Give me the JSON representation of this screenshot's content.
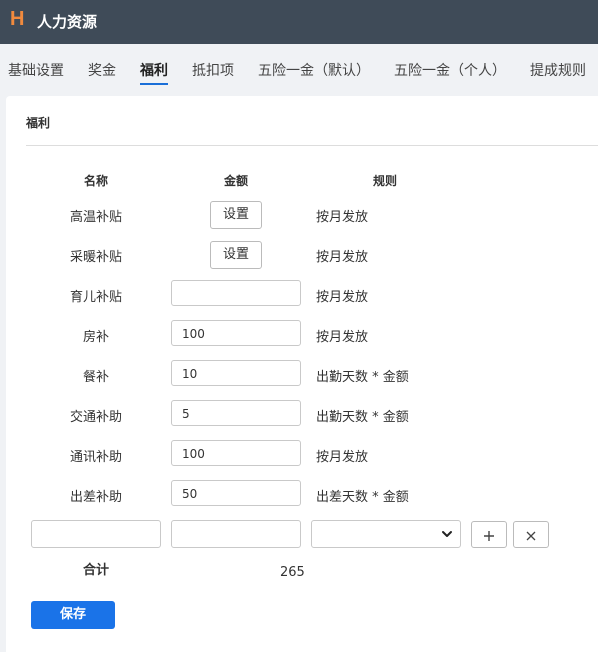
{
  "app": {
    "logo": "H",
    "title": "人力资源"
  },
  "tabs": [
    {
      "label": "基础设置",
      "active": false
    },
    {
      "label": "奖金",
      "active": false
    },
    {
      "label": "福利",
      "active": true
    },
    {
      "label": "抵扣项",
      "active": false
    },
    {
      "label": "五险一金（默认）",
      "active": false
    },
    {
      "label": "五险一金（个人）",
      "active": false
    },
    {
      "label": "提成规则",
      "active": false
    }
  ],
  "section": {
    "title": "福利"
  },
  "columns": {
    "name": "名称",
    "amount": "金额",
    "rule": "规则"
  },
  "rows": [
    {
      "name": "高温补贴",
      "amount_button": "设置",
      "rule": "按月发放"
    },
    {
      "name": "采暖补贴",
      "amount_button": "设置",
      "rule": "按月发放"
    },
    {
      "name": "育儿补贴",
      "amount": "",
      "rule": "按月发放"
    },
    {
      "name": "房补",
      "amount": "100",
      "rule": "按月发放"
    },
    {
      "name": "餐补",
      "amount": "10",
      "rule": "出勤天数 * 金额"
    },
    {
      "name": "交通补助",
      "amount": "5",
      "rule": "出勤天数 * 金额"
    },
    {
      "name": "通讯补助",
      "amount": "100",
      "rule": "按月发放"
    },
    {
      "name": "出差补助",
      "amount": "50",
      "rule": "出差天数 * 金额"
    }
  ],
  "new_row": {
    "name": "",
    "amount": "",
    "rule": "",
    "add_icon": "plus-icon",
    "remove_icon": "close-icon"
  },
  "total": {
    "label": "合计",
    "value": "265"
  },
  "actions": {
    "save": "保存"
  },
  "colors": {
    "header_bg": "#3f4b58",
    "logo": "#f08a3e",
    "accent": "#1a73e8"
  }
}
